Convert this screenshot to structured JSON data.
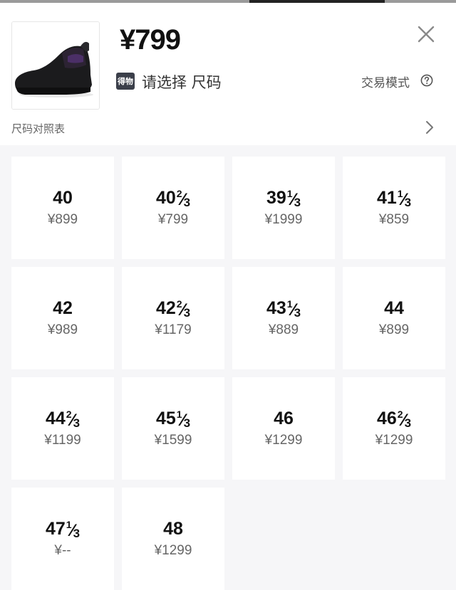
{
  "header": {
    "price": "¥799",
    "brand_badge": "得物",
    "prompt": "请选择 尺码",
    "trade_mode": "交易模式",
    "size_chart": "尺码对照表"
  },
  "sizes": [
    {
      "whole": "40",
      "num": "",
      "den": "",
      "price": "¥899"
    },
    {
      "whole": "40",
      "num": "2",
      "den": "3",
      "price": "¥799"
    },
    {
      "whole": "39",
      "num": "1",
      "den": "3",
      "price": "¥1999"
    },
    {
      "whole": "41",
      "num": "1",
      "den": "3",
      "price": "¥859"
    },
    {
      "whole": "42",
      "num": "",
      "den": "",
      "price": "¥989"
    },
    {
      "whole": "42",
      "num": "2",
      "den": "3",
      "price": "¥1179"
    },
    {
      "whole": "43",
      "num": "1",
      "den": "3",
      "price": "¥889"
    },
    {
      "whole": "44",
      "num": "",
      "den": "",
      "price": "¥899"
    },
    {
      "whole": "44",
      "num": "2",
      "den": "3",
      "price": "¥1199"
    },
    {
      "whole": "45",
      "num": "1",
      "den": "3",
      "price": "¥1599"
    },
    {
      "whole": "46",
      "num": "",
      "den": "",
      "price": "¥1299"
    },
    {
      "whole": "46",
      "num": "2",
      "den": "3",
      "price": "¥1299"
    },
    {
      "whole": "47",
      "num": "1",
      "den": "3",
      "price": "¥--"
    },
    {
      "whole": "48",
      "num": "",
      "den": "",
      "price": "¥1299"
    }
  ],
  "icons": {
    "close": "close-icon",
    "help": "question-circle-icon",
    "chevron": "chevron-right-icon",
    "product": "sneaker-image"
  },
  "colors": {
    "background": "#f6f6f8",
    "card": "#ffffff",
    "price_text": "#666666"
  }
}
